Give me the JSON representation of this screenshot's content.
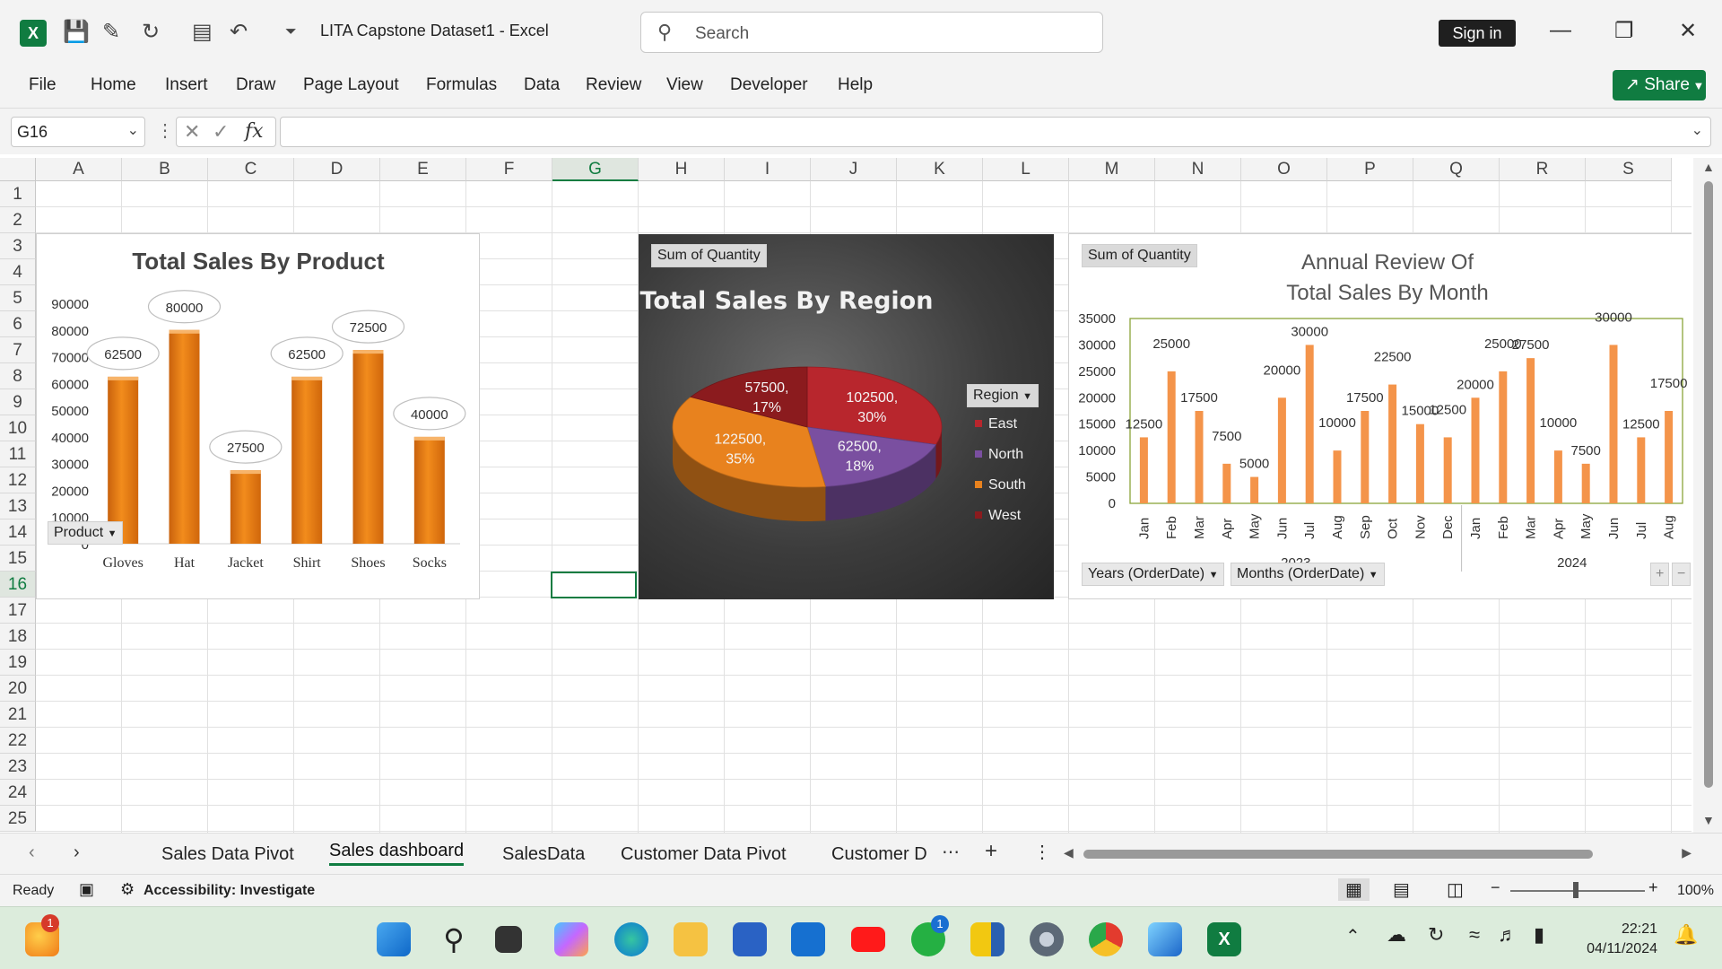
{
  "window": {
    "title": "LITA Capstone Dataset1  -  Excel",
    "search_placeholder": "Search",
    "sign_in": "Sign in",
    "share": "Share"
  },
  "menu": [
    "File",
    "Home",
    "Insert",
    "Draw",
    "Page Layout",
    "Formulas",
    "Data",
    "Review",
    "View",
    "Developer",
    "Help"
  ],
  "formula_bar": {
    "name_box": "G16",
    "fx": "fx",
    "value": ""
  },
  "columns": [
    "A",
    "B",
    "C",
    "D",
    "E",
    "F",
    "G",
    "H",
    "I",
    "J",
    "K",
    "L",
    "M",
    "N",
    "O",
    "P",
    "Q",
    "R",
    "S"
  ],
  "selected_column": "G",
  "rows": [
    "1",
    "2",
    "3",
    "4",
    "5",
    "6",
    "7",
    "8",
    "9",
    "10",
    "11",
    "12",
    "13",
    "14",
    "15",
    "16",
    "17",
    "18",
    "19",
    "20",
    "21",
    "22",
    "23",
    "24",
    "25"
  ],
  "selected_row": "16",
  "charts": {
    "product": {
      "title": "Total Sales By Product",
      "field_button": "Product",
      "color": "#f28c1c"
    },
    "region": {
      "title": "Total Sales By Region",
      "field_button": "Sum of Quantity",
      "legend_title": "Region",
      "colors": [
        "#b8262d",
        "#7a4fa0",
        "#e8821e",
        "#8b1b1e"
      ]
    },
    "monthly": {
      "title_line1": "Annual Review Of",
      "title_line2": "Total Sales By Month",
      "field_button": "Sum of Quantity",
      "filter1": "Years (OrderDate)",
      "filter2": "Months (OrderDate)",
      "color": "#f4944a"
    }
  },
  "chart_data": [
    {
      "type": "bar",
      "title": "Total Sales By Product",
      "categories": [
        "Gloves",
        "Hat",
        "Jacket",
        "Shirt",
        "Shoes",
        "Socks"
      ],
      "values": [
        62500,
        80000,
        27500,
        62500,
        72500,
        40000
      ],
      "yticks": [
        "90000",
        "80000",
        "70000",
        "60000",
        "50000",
        "40000",
        "30000",
        "20000",
        "10000",
        "0"
      ],
      "ylim": [
        0,
        90000
      ]
    },
    {
      "type": "pie",
      "title": "Total Sales By Region",
      "legend": [
        "East",
        "North",
        "South",
        "West"
      ],
      "slices": [
        {
          "name": "East",
          "value": 102500,
          "label": "102500,\n30%"
        },
        {
          "name": "North",
          "value": 62500,
          "label": "62500,\n18%"
        },
        {
          "name": "South",
          "value": 122500,
          "label": "122500,\n35%"
        },
        {
          "name": "West",
          "value": 57500,
          "label": "57500,\n17%"
        }
      ]
    },
    {
      "type": "bar",
      "title": "Annual Review Of Total Sales By Month",
      "categories": [
        "Jan",
        "Feb",
        "Mar",
        "Apr",
        "May",
        "Jun",
        "Jul",
        "Aug",
        "Sep",
        "Oct",
        "Nov",
        "Dec",
        "Jan",
        "Feb",
        "Mar",
        "Apr",
        "May",
        "Jun",
        "Jul",
        "Aug"
      ],
      "groups": [
        {
          "label": "2023",
          "count": 12
        },
        {
          "label": "2024",
          "count": 8
        }
      ],
      "values": [
        12500,
        25000,
        17500,
        7500,
        5000,
        20000,
        30000,
        10000,
        17500,
        22500,
        15000,
        12500,
        20000,
        25000,
        27500,
        10000,
        7500,
        30000,
        12500,
        17500
      ],
      "yticks": [
        "35000",
        "30000",
        "25000",
        "20000",
        "15000",
        "10000",
        "5000",
        "0"
      ],
      "ylim": [
        0,
        35000
      ]
    }
  ],
  "sheets": {
    "tabs": [
      "Sales Data Pivot",
      "Sales dashboard",
      "SalesData",
      "Customer Data Pivot",
      "Customer D"
    ],
    "active": "Sales dashboard"
  },
  "status": {
    "ready": "Ready",
    "accessibility": "Accessibility: Investigate",
    "zoom": "100%"
  },
  "taskbar": {
    "time": "22:21",
    "date": "04/11/2024",
    "badge_left": "1",
    "badge_whatsapp": "1"
  }
}
